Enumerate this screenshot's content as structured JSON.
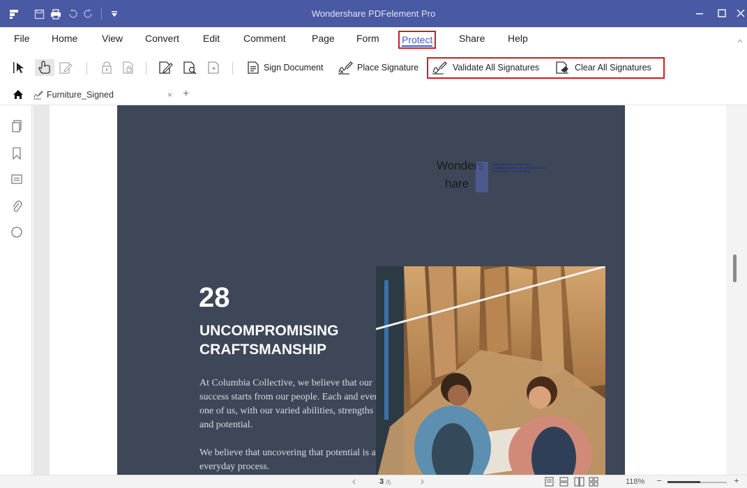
{
  "window": {
    "title": "Wondershare PDFelement Pro"
  },
  "menu": {
    "items": [
      "File",
      "Home",
      "View",
      "Convert",
      "Edit",
      "Comment",
      "Page",
      "Form",
      "Protect",
      "Share",
      "Help"
    ],
    "active": "Protect"
  },
  "toolbar": {
    "sign_document": "Sign Document",
    "place_signature": "Place Signature",
    "validate_all": "Validate All Signatures",
    "clear_all": "Clear All Signatures"
  },
  "tab": {
    "name": "Furniture_Signed",
    "close": "×",
    "add": "+"
  },
  "document": {
    "number": "28",
    "heading_line1": "UNCOMPROMISING",
    "heading_line2": "CRAFTSMANSHIP",
    "paragraph1": "At Columbia Collective, we believe that our success starts from our people. Each and every one of us, with our varied abilities, strengths and potential.",
    "paragraph2": "We believe that uncovering that potential is an everyday process.",
    "signature": {
      "line1": "Wonders",
      "line2": "hare",
      "details": "Digital Signed Wondershare (PL) Email@wondershare.com, CN=Wondershare Date:2019.05.17 16:12:05 +08:00"
    }
  },
  "status": {
    "page_current": "3",
    "page_total": "/5",
    "zoom": "118%",
    "zoom_level": 0.55
  },
  "colors": {
    "titlebar": "#4a59a3",
    "accent": "#3a5fc8",
    "highlight_box": "#d11b1b",
    "panel": "#3d4758"
  }
}
